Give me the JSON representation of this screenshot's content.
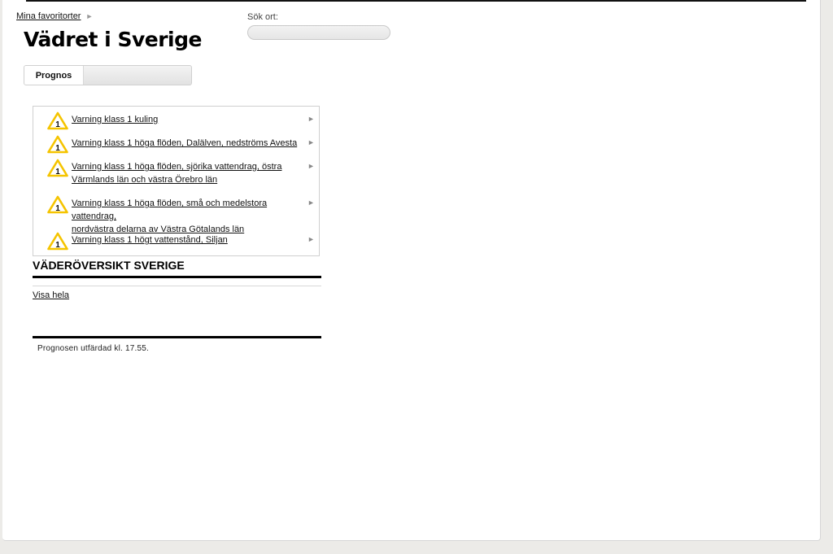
{
  "breadcrumb": {
    "link": "Mina favoritorter",
    "arrow": "►"
  },
  "page_title": "Vädret i Sverige",
  "search": {
    "label": "Sök ort:",
    "value": "",
    "placeholder": ""
  },
  "tabs": {
    "active": "Prognos"
  },
  "warnings": {
    "level": "1",
    "arrow": "►",
    "items": [
      {
        "line1": "Varning klass 1 kuling",
        "line2": ""
      },
      {
        "line1": "Varning klass 1 höga flöden, Dalälven, nedströms Avesta",
        "line2": ""
      },
      {
        "line1": "Varning klass 1 höga flöden, sjörika vattendrag, östra",
        "line2": "Värmlands län och västra Örebro län"
      },
      {
        "line1": "Varning klass 1 höga flöden, små och medelstora vattendrag,",
        "line2": "nordvästra delarna av Västra Götalands län"
      },
      {
        "line1": "Varning klass 1 högt vattenstånd, Siljan",
        "line2": ""
      }
    ]
  },
  "overview": {
    "title": "VÄDERÖVERSIKT SVERIGE",
    "show_all": "Visa hela",
    "issued": "Prognosen utfärdad kl. 17.55."
  },
  "colors": {
    "warning_yellow": "#f5c400",
    "text": "#111111",
    "page_bg": "#ecebe8"
  },
  "icons": {
    "warning": "warning-triangle-icon",
    "arrow": "arrow-right-icon"
  }
}
